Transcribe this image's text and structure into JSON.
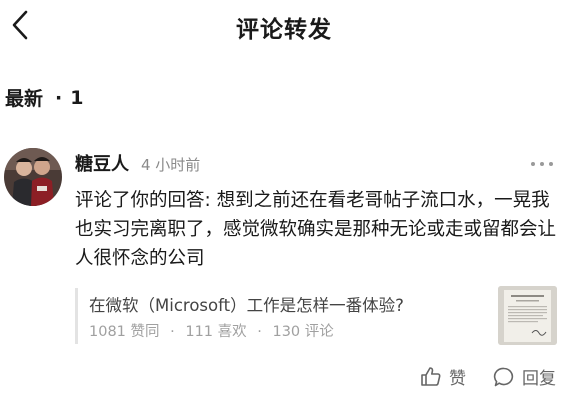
{
  "header": {
    "title": "评论转发",
    "back_icon": "chevron-left-icon"
  },
  "sort": {
    "label": "最新",
    "separator": "·",
    "count": "1"
  },
  "item": {
    "avatar_icon": "user-avatar",
    "username": "糖豆人",
    "timestamp": "4 小时前",
    "more_icon": "more-horizontal-icon",
    "content": "评论了你的回答: 想到之前还在看老哥帖子流口水，一晃我也实习完离职了，感觉微软确实是那种无论或走或留都会让人很怀念的公司",
    "quote": {
      "title": "在微软（Microsoft）工作是怎样一番体验?",
      "stats": {
        "likes": "1081 赞同",
        "favorites": "111 喜欢",
        "comments": "130 评论",
        "separator": "·"
      },
      "thumbnail": "document-thumbnail"
    },
    "actions": {
      "like_label": "赞",
      "like_icon": "thumbs-up-icon",
      "reply_label": "回复",
      "reply_icon": "comment-bubble-icon"
    }
  },
  "colors": {
    "text_primary": "#1a1a1a",
    "text_secondary": "#8a8a8a",
    "quote_bar": "#e3e3e3"
  }
}
